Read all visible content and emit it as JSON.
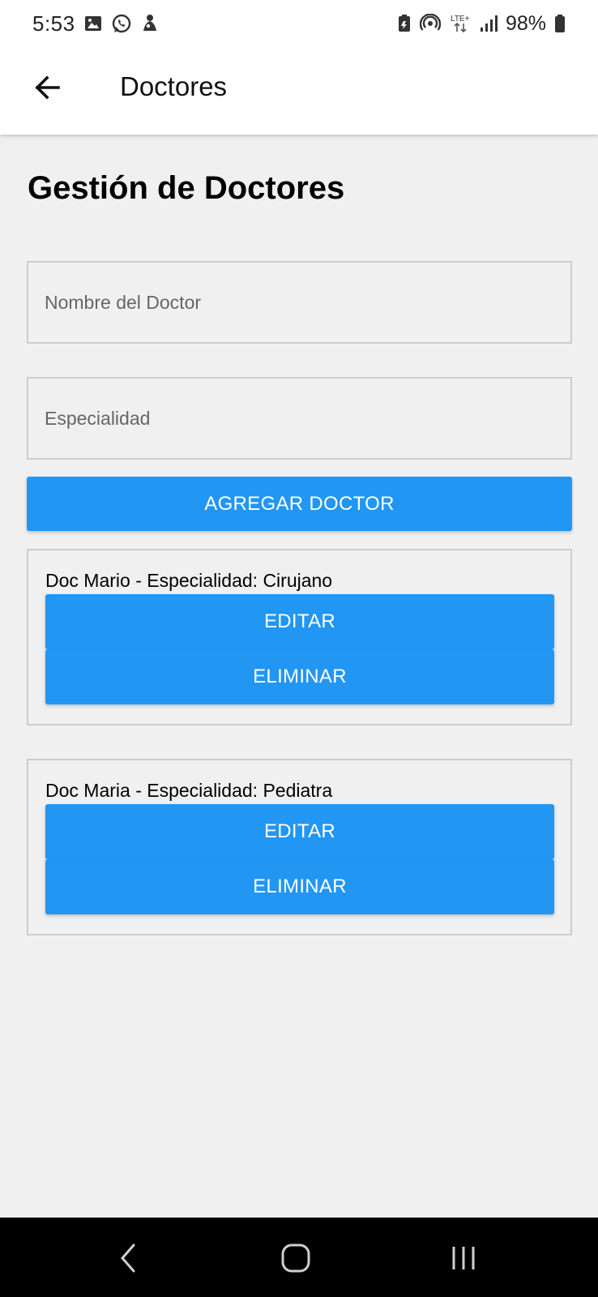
{
  "status_bar": {
    "time": "5:53",
    "battery_percent": "98%",
    "left_icons": [
      "gallery-icon",
      "whatsapp-icon",
      "assistant-icon"
    ],
    "right_icons": [
      "battery-saver-icon",
      "hotspot-icon",
      "lte-plus-icon",
      "signal-icon",
      "battery-icon"
    ]
  },
  "app_bar": {
    "title": "Doctores",
    "back_icon": "arrow-left-icon"
  },
  "main": {
    "title": "Gestión de Doctores",
    "name_input": {
      "placeholder": "Nombre del Doctor",
      "value": ""
    },
    "specialty_input": {
      "placeholder": "Especialidad",
      "value": ""
    },
    "add_button": "AGREGAR DOCTOR",
    "doctors": [
      {
        "text": "Doc Mario - Especialidad: Cirujano",
        "edit_label": "EDITAR",
        "delete_label": "ELIMINAR"
      },
      {
        "text": "Doc Maria - Especialidad: Pediatra",
        "edit_label": "EDITAR",
        "delete_label": "ELIMINAR"
      }
    ]
  },
  "nav_bar": {
    "buttons": [
      "back-nav-icon",
      "home-nav-icon",
      "recents-nav-icon"
    ]
  },
  "colors": {
    "primary": "#2196f3",
    "background": "#f0f0f0",
    "surface": "#ffffff",
    "border": "#cdcdcd",
    "nav_bar": "#000000"
  }
}
